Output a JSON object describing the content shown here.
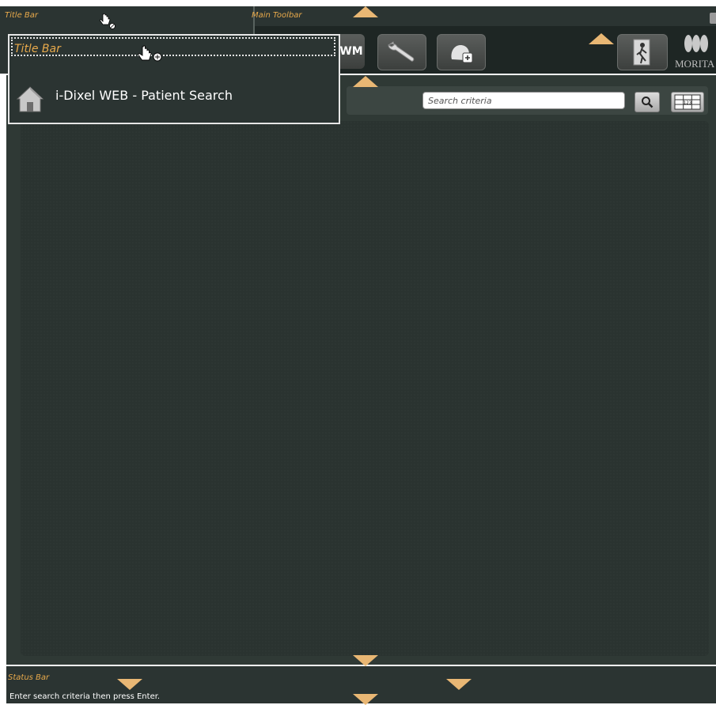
{
  "title_bar": {
    "label": "Title Bar"
  },
  "main_toolbar": {
    "label": "Main Toolbar",
    "buttons": [
      {
        "label": "WM"
      },
      {
        "icon": "wrench-icon"
      },
      {
        "icon": "add-patient-icon"
      },
      {
        "icon": "exit-door-icon"
      },
      {
        "icon": "morita-logo-icon",
        "label": "MORITA"
      }
    ]
  },
  "drag_popup": {
    "label": "Title Bar",
    "app_title": "i-Dixel WEB - Patient Search",
    "icon": "home-icon"
  },
  "search": {
    "placeholder": "Search criteria",
    "search_icon": "magnifier-icon",
    "keypad_icon": "keypad-icon",
    "keypad_text": "123"
  },
  "status_bar": {
    "label": "Status Bar",
    "message": "Enter search criteria then press Enter."
  },
  "colors": {
    "background": "#2b3432",
    "accent": "#e9b774",
    "label": "#e7a94b"
  }
}
